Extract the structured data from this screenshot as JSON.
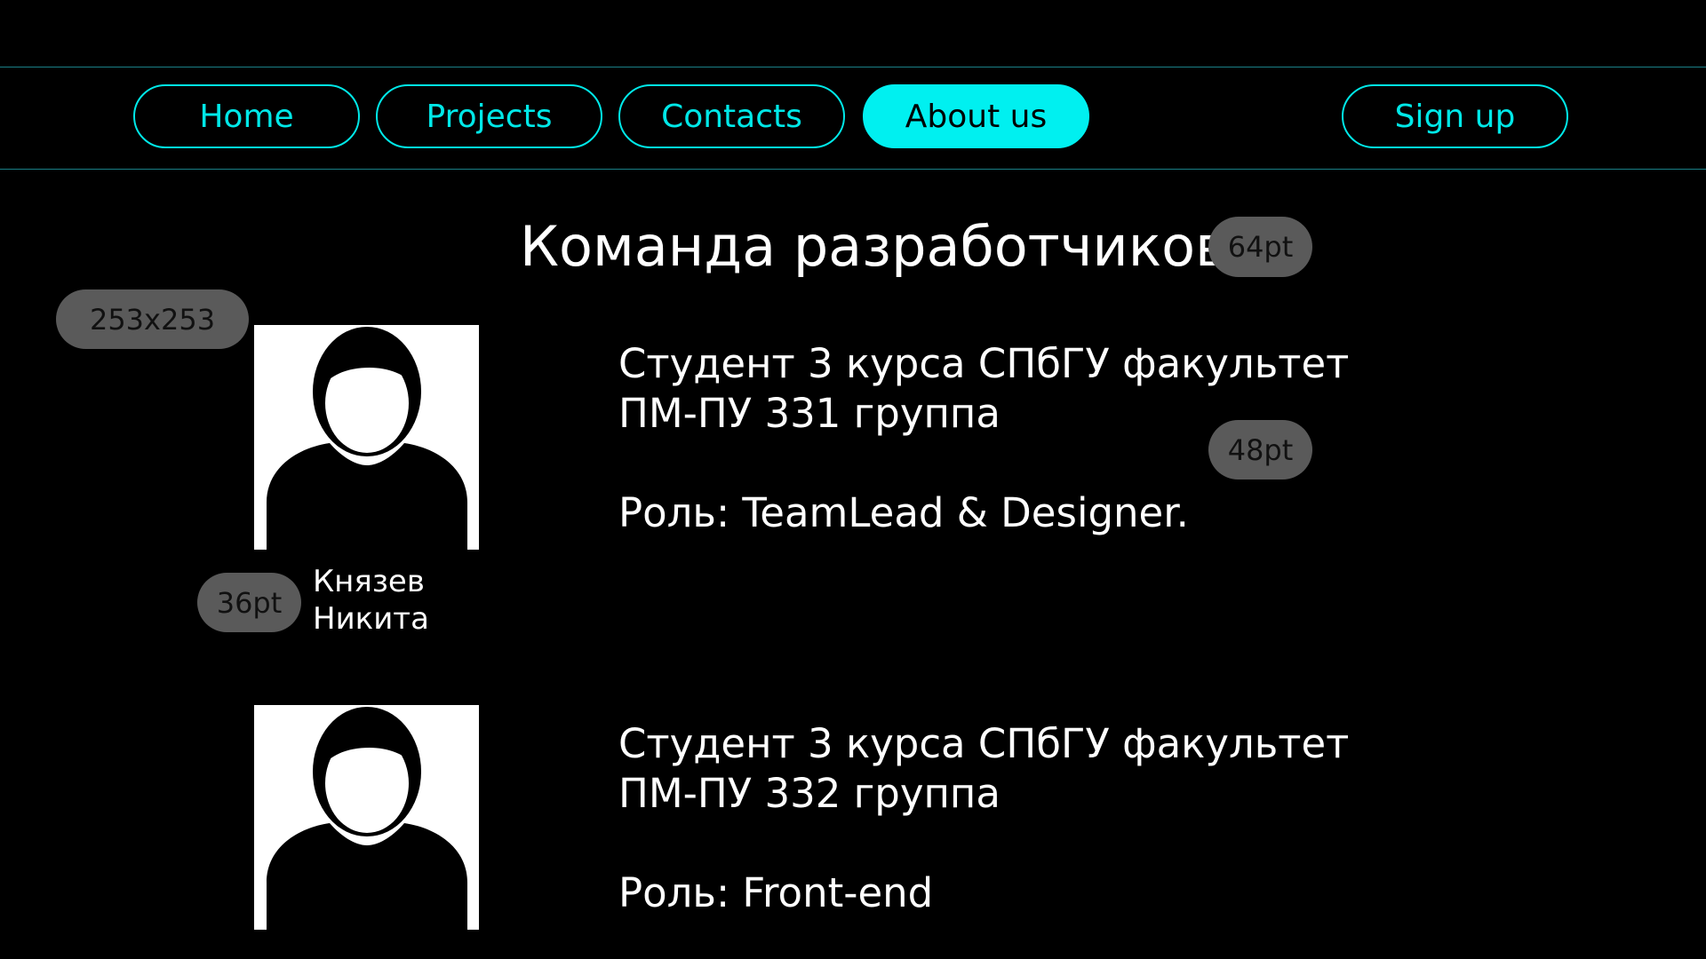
{
  "nav": {
    "home": "Home",
    "projects": "Projects",
    "contacts": "Contacts",
    "about": "About us",
    "signup": "Sign up"
  },
  "page": {
    "title": "Команда разработчиков"
  },
  "annotations": {
    "title_size": "64pt",
    "avatar_size": "253x253",
    "bio_size": "48pt",
    "name_size": "36pt"
  },
  "members": [
    {
      "name_first_line": "Князев",
      "name_second_line": "Никита",
      "bio_line1": "Студент 3 курса СПбГУ факультет",
      "bio_line2": "ПМ-ПУ 331 группа",
      "role": "Роль: TeamLead & Designer."
    },
    {
      "bio_line1": "Студент 3 курса СПбГУ факультет",
      "bio_line2": "ПМ-ПУ 332 группа",
      "role": "Роль: Front-end"
    }
  ],
  "colors": {
    "accent": "#00e8e8",
    "background": "#000000",
    "badge": "#5a5a5a"
  },
  "icons": {
    "avatar": "user-silhouette-icon"
  }
}
